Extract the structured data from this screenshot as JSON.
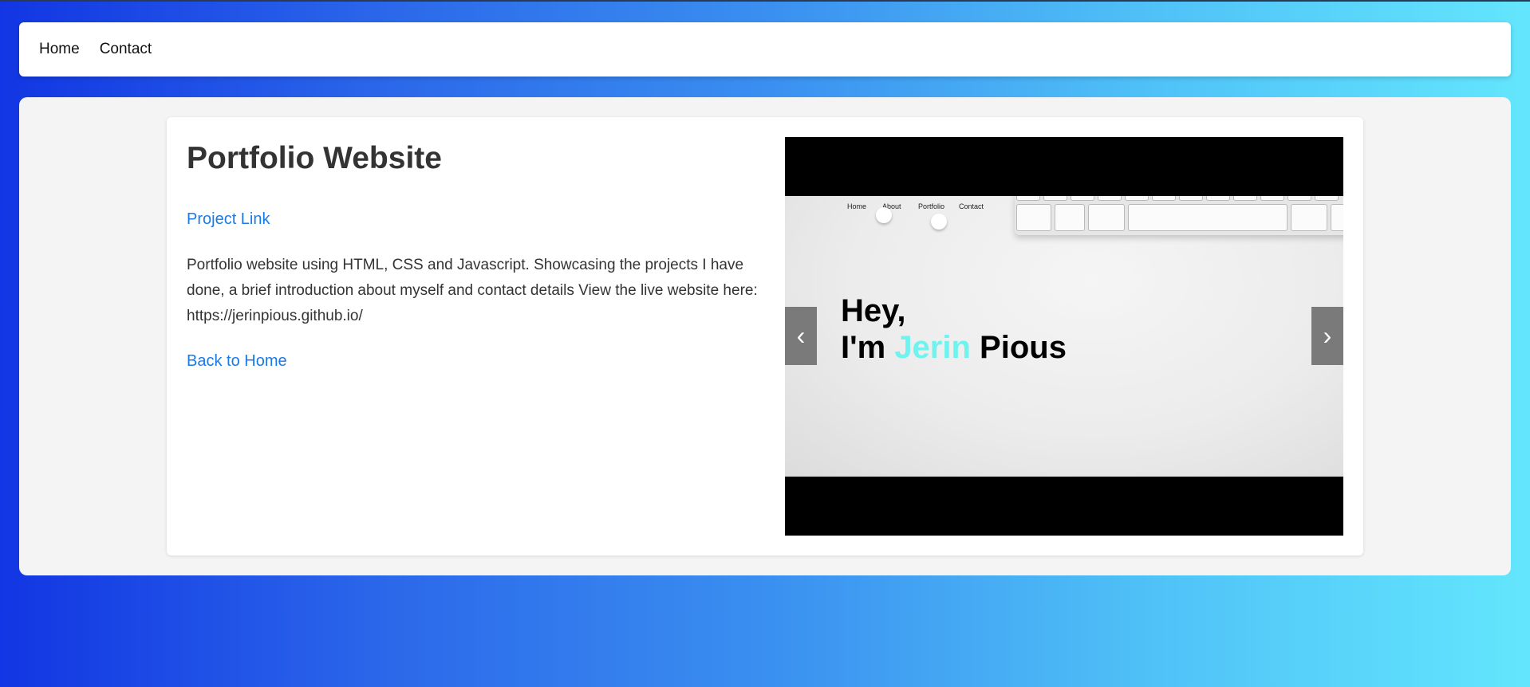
{
  "nav": {
    "items": [
      {
        "label": "Home"
      },
      {
        "label": "Contact"
      }
    ]
  },
  "project": {
    "title": "Portfolio Website",
    "project_link": "Project Link",
    "description": "Portfolio website using HTML, CSS and Javascript. Showcasing the projects I have done, a brief introduction about myself and contact details View the live website here: https://jerinpious.github.io/",
    "back_link": "Back to Home"
  },
  "carousel": {
    "slide": {
      "mini_nav": [
        "Home",
        "About",
        "Portfolio",
        "Contact"
      ],
      "hero_line1": "Hey,",
      "hero_prefix": "I'm ",
      "hero_accent": "Jerin",
      "hero_suffix": " Pious",
      "accent_color": "#6ff3ee"
    },
    "prev_icon": "‹",
    "next_icon": "›"
  },
  "colors": {
    "link": "#1a7ae6",
    "background_gradient": [
      "#1236e3",
      "#63e6fd"
    ]
  },
  "icons": {
    "prev": "chevron-left-icon",
    "next": "chevron-right-icon"
  }
}
